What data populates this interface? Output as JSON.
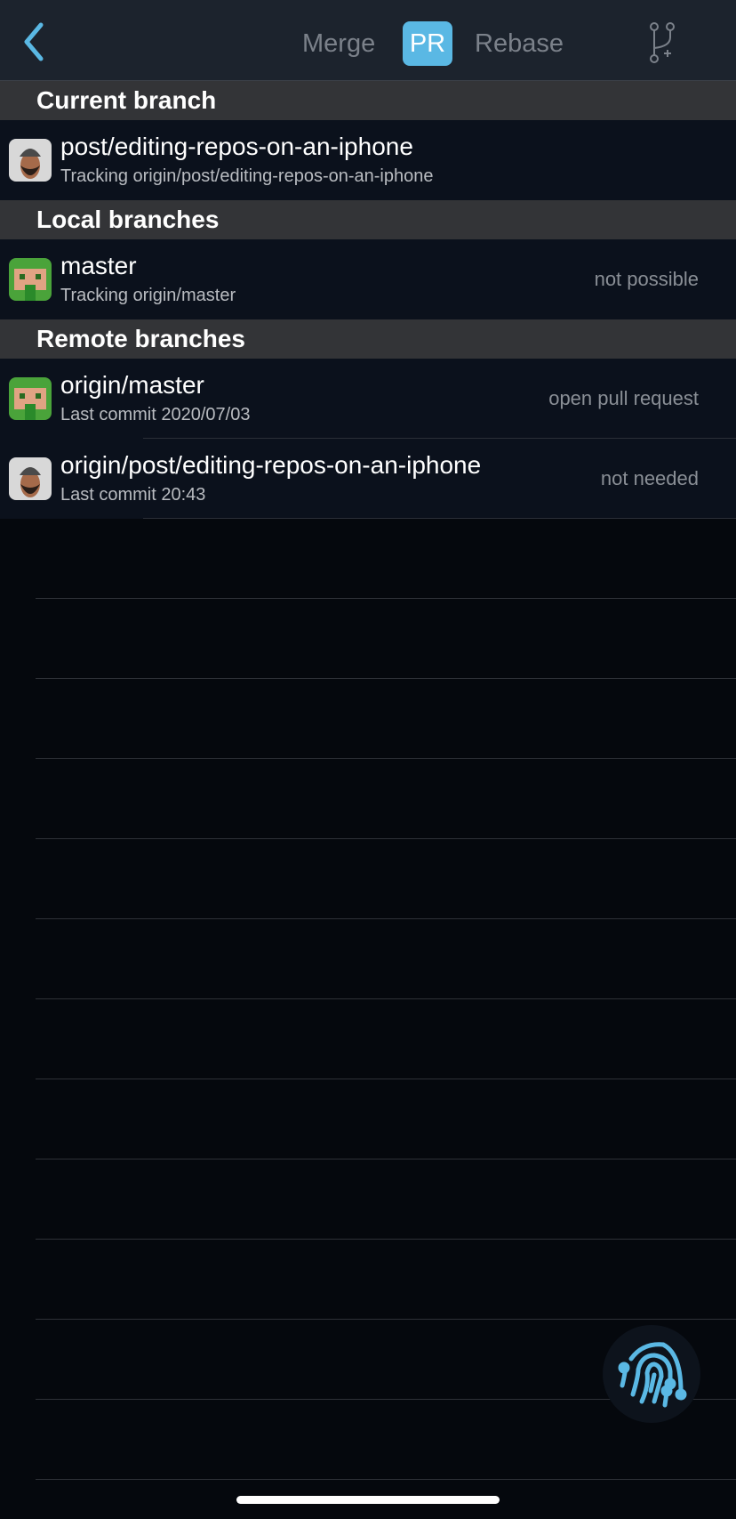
{
  "header": {
    "segments": [
      {
        "label": "Merge",
        "selected": false
      },
      {
        "label": "PR",
        "selected": true
      },
      {
        "label": "Rebase",
        "selected": false
      }
    ],
    "accent": "#5ab8e4"
  },
  "sections": {
    "current": {
      "title": "Current branch",
      "rows": [
        {
          "name": "post/editing-repos-on-an-iphone",
          "sub": "Tracking origin/post/editing-repos-on-an-iphone",
          "status": "",
          "avatar": "memoji"
        }
      ]
    },
    "local": {
      "title": "Local branches",
      "rows": [
        {
          "name": "master",
          "sub": "Tracking origin/master",
          "status": "not possible",
          "avatar": "pixel"
        }
      ]
    },
    "remote": {
      "title": "Remote branches",
      "rows": [
        {
          "name": "origin/master",
          "sub": "Last commit 2020/07/03",
          "status": "open pull request",
          "avatar": "pixel"
        },
        {
          "name": "origin/post/editing-repos-on-an-iphone",
          "sub": "Last commit 20:43",
          "status": "not needed",
          "avatar": "memoji"
        }
      ]
    }
  }
}
